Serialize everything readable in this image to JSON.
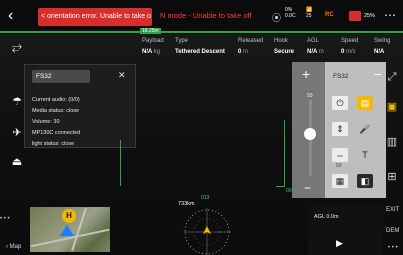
{
  "topbar": {
    "back_icon": "chevron-left-icon",
    "error_banner": "< orientation error. Unable to take o",
    "mode_text": "N mode - Unable to take off",
    "speed_label": "0%",
    "temp_value": "0.0C",
    "signal_label": "25",
    "rc_label": "RC",
    "battery_value": "25%",
    "menu_icon": "ellipsis-icon"
  },
  "altitude_marker": "18.25m",
  "telemetry": {
    "payload": {
      "header": "Payload",
      "value": "N/A",
      "unit": "kg"
    },
    "type": {
      "header": "Type",
      "value": "Tethered Descent"
    },
    "released": {
      "header": "Released",
      "value": "0",
      "unit": "m"
    },
    "hook": {
      "header": "Hook",
      "value": "Secure"
    },
    "agl": {
      "header": "AGL",
      "value": "N/A",
      "unit": "m"
    },
    "speed": {
      "header": "Speed",
      "value": "0",
      "unit": "m/s"
    },
    "swing": {
      "header": "Swing",
      "value": "N/A"
    }
  },
  "audio_panel": {
    "device": "FS32",
    "lines": [
      "Current audio: (0/0)",
      "Media status: close",
      "Volume: 30",
      "MP130C connected",
      "light status: close"
    ]
  },
  "speaker_panel": {
    "device": "FS32",
    "volume_top_label": "50",
    "volume_value": 30,
    "label_50": "50"
  },
  "compass": {
    "distance_label": "733km",
    "heading_value": "013"
  },
  "bottom": {
    "agl_label": "AGL 0.0m",
    "exit_label": "EXIT",
    "dem_label": "DEM",
    "map_label": "Map"
  },
  "colors": {
    "error_red": "#d82d2d",
    "accent_green": "#2da34a",
    "yellow": "#f5b800",
    "rc_orange": "#ff6a1a"
  }
}
